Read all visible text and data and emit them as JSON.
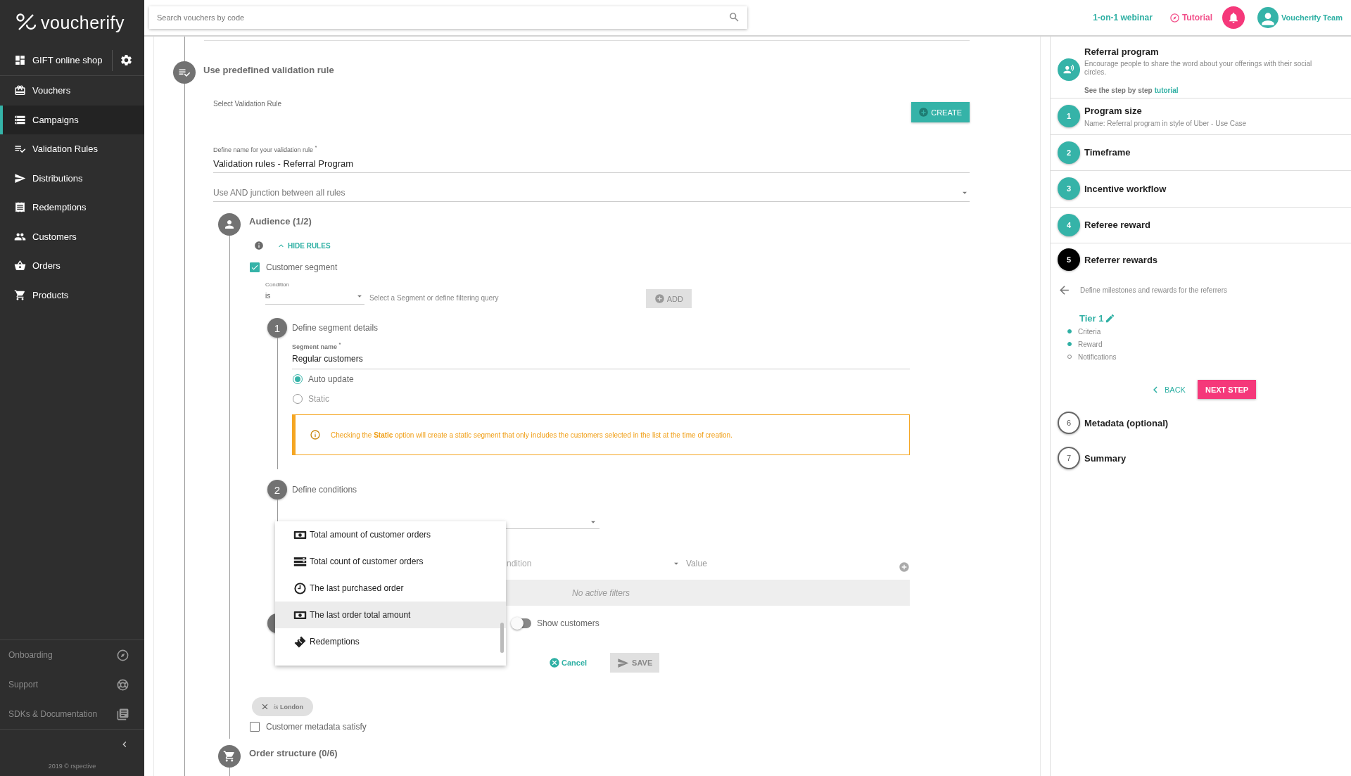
{
  "sidebar": {
    "logo": "voucherify",
    "store": "GIFT online shop",
    "items": [
      {
        "label": "Vouchers",
        "selected": false
      },
      {
        "label": "Campaigns",
        "selected": true
      },
      {
        "label": "Validation Rules",
        "selected": false
      },
      {
        "label": "Distributions",
        "selected": false
      },
      {
        "label": "Redemptions",
        "selected": false
      },
      {
        "label": "Customers",
        "selected": false
      },
      {
        "label": "Orders",
        "selected": false
      },
      {
        "label": "Products",
        "selected": false
      }
    ],
    "footer_items": [
      "Onboarding",
      "Support",
      "SDKs & Documentation"
    ],
    "copyright": "2019 © rspective"
  },
  "top_bar": {
    "search": {
      "placeholder": "Search vouchers by code"
    },
    "webinar_link": "1-on-1 webinar",
    "tutorial_link": "Tutorial",
    "user": "Voucherify Team"
  },
  "form": {
    "section_title": "Use predefined validation rule",
    "select_rule_label": "Select Validation Rule",
    "create_button": "CREATE",
    "name_field": {
      "label": "Define name for your validation rule $^{*}$",
      "value": "Validation rules - Referral Program"
    },
    "junction_select": {
      "value": "Use AND junction between all rules"
    },
    "audience": {
      "title": "Audience (1/2)",
      "rules_toggle": "HIDE RULES",
      "customer_segment": {
        "label": "Customer segment",
        "checked": true
      },
      "condition": {
        "label": "Condition",
        "value": "is"
      },
      "segment_hint": "Select a Segment or define filtering query",
      "add_button": "ADD",
      "segment_step": {
        "number": "1",
        "title": "Define segment details",
        "name_label": "Segment name $^{*}$",
        "name_value": "Regular customers",
        "update_options": [
          {
            "label": "Auto update",
            "selected": true
          },
          {
            "label": "Static",
            "selected": false
          }
        ],
        "alert": "Checking the **Static** option will create a static segment that only includes the customers selected in the list at the time of creation."
      },
      "conditions_step": {
        "number": "2",
        "title": "Define conditions",
        "condition_placeholder": "ndition",
        "value_placeholder": "Value",
        "empty_text": "No active filters"
      },
      "property_menu": [
        {
          "label": "Total amount of customer orders",
          "selected": false
        },
        {
          "label": "Total count of customer orders",
          "selected": false
        },
        {
          "label": "The last purchased order",
          "selected": false
        },
        {
          "label": "The last order total amount",
          "selected": true
        },
        {
          "label": "Redemptions",
          "selected": false
        }
      ],
      "show_customers": {
        "label": "Show customers",
        "on": false
      },
      "cancel_button": "Cancel",
      "save_button": {
        "label": "SAVE",
        "disabled": true
      },
      "chips": [
        {
          "label": "*is* **London**"
        }
      ],
      "metadata": {
        "label": "Customer metadata satisfy",
        "checked": false
      }
    },
    "order_structure": {
      "title": "Order structure (0/6)"
    }
  },
  "wizard": {
    "header": {
      "title": "Referral program",
      "description": "Encourage people to share the word about your offerings with their social circles.",
      "tutorial_prefix": "See the step by step",
      "tutorial_link": "tutorial"
    },
    "steps": [
      {
        "number": "1",
        "title": "Program size",
        "subtitle": "Name: Referral program in style of Uber - Use Case",
        "completed": true,
        "active": false
      },
      {
        "number": "2",
        "title": "Timeframe",
        "completed": true,
        "active": false
      },
      {
        "number": "3",
        "title": "Incentive workflow",
        "completed": true,
        "active": false
      },
      {
        "number": "4",
        "title": "Referee reward",
        "completed": true,
        "active": false
      },
      {
        "number": "5",
        "title": "Referrer rewards",
        "completed": false,
        "active": true
      },
      {
        "number": "6",
        "title": "Metadata (optional)",
        "completed": false,
        "active": false
      },
      {
        "number": "7",
        "title": "Summary",
        "completed": false,
        "active": false
      }
    ],
    "active_step": {
      "description": "Define milestones and rewards for the referrers",
      "tier": "Tier 1",
      "tasks": [
        {
          "label": "Criteria",
          "done": true
        },
        {
          "label": "Reward",
          "done": true
        },
        {
          "label": "Notifications",
          "done": false
        }
      ],
      "back_button": "BACK",
      "next_button": "NEXT STEP"
    }
  }
}
